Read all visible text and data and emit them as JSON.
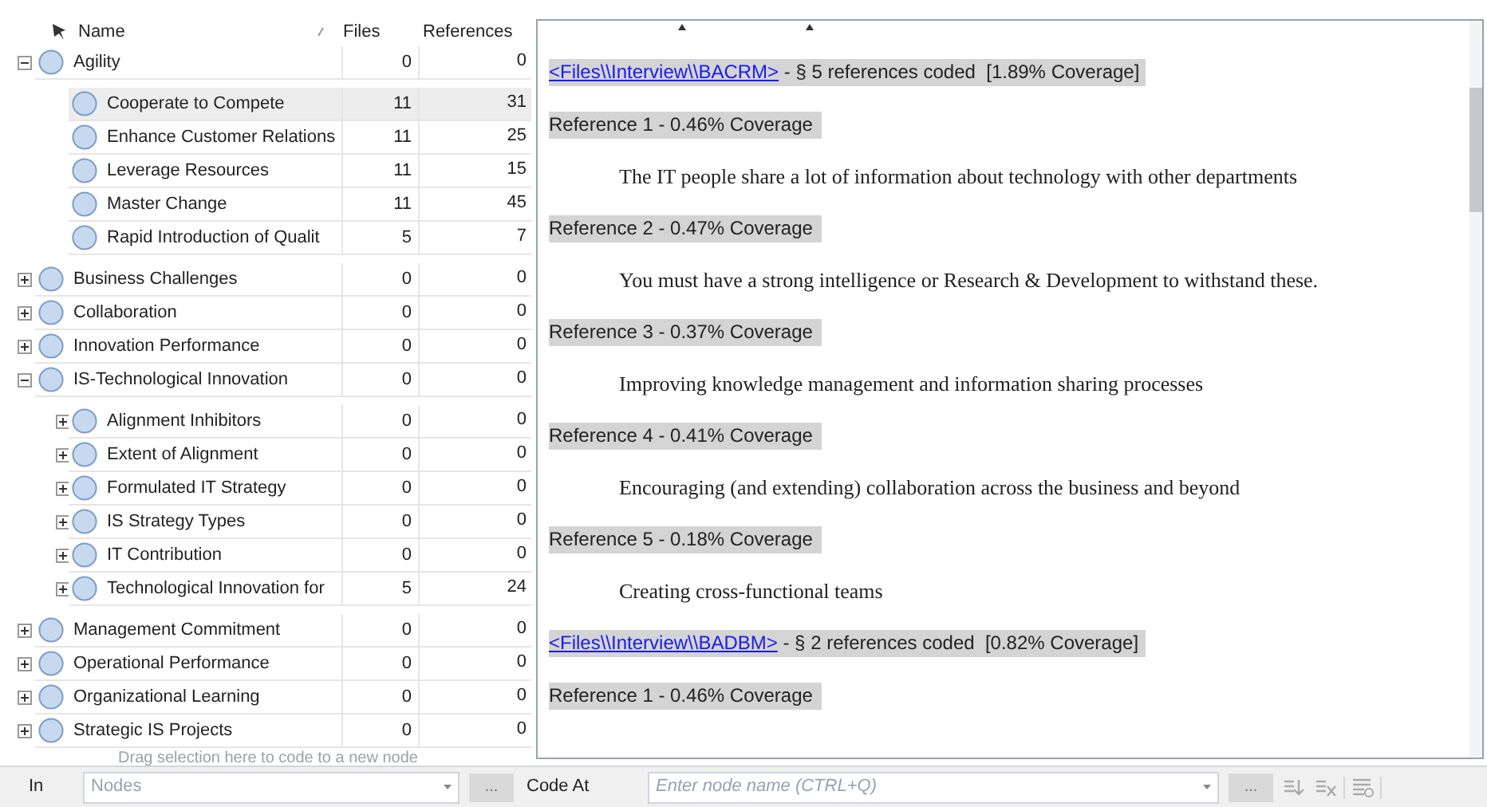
{
  "node_list": {
    "columns": [
      "Name",
      "Files",
      "References"
    ],
    "nodes": [
      {
        "name": "Agility",
        "files": "0",
        "references": "0",
        "expanded": true,
        "selected": false,
        "children": [
          {
            "name": "Cooperate to Compete",
            "files": "11",
            "references": "31",
            "selected": true
          },
          {
            "name": "Enhance Customer Relations",
            "files": "11",
            "references": "25",
            "selected": false
          },
          {
            "name": "Leverage Resources",
            "files": "11",
            "references": "15",
            "selected": false
          },
          {
            "name": "Master Change",
            "files": "11",
            "references": "45",
            "selected": false
          },
          {
            "name": "Rapid Introduction of Qualit",
            "files": "5",
            "references": "7",
            "selected": false
          }
        ]
      },
      {
        "name": "Business Challenges",
        "files": "0",
        "references": "0",
        "expanded": false,
        "selected": false
      },
      {
        "name": "Collaboration",
        "files": "0",
        "references": "0",
        "expanded": false,
        "selected": false
      },
      {
        "name": "Innovation Performance",
        "files": "0",
        "references": "0",
        "expanded": false,
        "selected": false
      },
      {
        "name": "IS-Technological Innovation",
        "files": "0",
        "references": "0",
        "expanded": true,
        "selected": false,
        "children": [
          {
            "name": "Alignment Inhibitors",
            "files": "0",
            "references": "0",
            "expanded": false,
            "selected": false
          },
          {
            "name": "Extent of Alignment",
            "files": "0",
            "references": "0",
            "expanded": false,
            "selected": false
          },
          {
            "name": "Formulated IT Strategy",
            "files": "0",
            "references": "0",
            "expanded": false,
            "selected": false
          },
          {
            "name": "IS Strategy Types",
            "files": "0",
            "references": "0",
            "expanded": false,
            "selected": false
          },
          {
            "name": "IT Contribution",
            "files": "0",
            "references": "0",
            "expanded": false,
            "selected": false
          },
          {
            "name": "Technological Innovation for",
            "files": "5",
            "references": "24",
            "expanded": false,
            "selected": false
          }
        ]
      },
      {
        "name": "Management Commitment",
        "files": "0",
        "references": "0",
        "expanded": false,
        "selected": false
      },
      {
        "name": "Operational Performance",
        "files": "0",
        "references": "0",
        "expanded": false,
        "selected": false
      },
      {
        "name": "Organizational Learning",
        "files": "0",
        "references": "0",
        "expanded": false,
        "selected": false
      },
      {
        "name": "Strategic IS Projects",
        "files": "0",
        "references": "0",
        "expanded": false,
        "selected": false
      }
    ],
    "drop_hint": "Drag selection here to code to a new node"
  },
  "detail_view": {
    "blocks": [
      {
        "kind": "source",
        "link": "<Files\\\\Interview\\\\BACRM>",
        "summary": " - § 5 references coded  [1.89% Coverage]"
      },
      {
        "kind": "reference",
        "text": "Reference 1 - 0.46% Coverage"
      },
      {
        "kind": "quote",
        "text": "The IT people share a lot of information about technology with other departments"
      },
      {
        "kind": "reference",
        "text": "Reference 2 - 0.47% Coverage"
      },
      {
        "kind": "quote",
        "text": "You must have a strong intelligence or Research & Development to withstand these."
      },
      {
        "kind": "reference",
        "text": "Reference 3 - 0.37% Coverage"
      },
      {
        "kind": "quote",
        "text": "Improving knowledge management and information sharing processes"
      },
      {
        "kind": "reference",
        "text": "Reference 4 - 0.41% Coverage"
      },
      {
        "kind": "quote",
        "text": "Encouraging (and extending) collaboration across the business and beyond"
      },
      {
        "kind": "reference",
        "text": "Reference 5 - 0.18% Coverage"
      },
      {
        "kind": "quote",
        "text": "Creating cross-functional teams"
      },
      {
        "kind": "source",
        "link": "<Files\\\\Interview\\\\BADBM>",
        "summary": " - § 2 references coded  [0.82% Coverage]"
      },
      {
        "kind": "reference",
        "text": "Reference 1 - 0.46% Coverage"
      }
    ]
  },
  "code_bar": {
    "in_label": "In",
    "in_placeholder": "Nodes",
    "in_button": "...",
    "code_at_label": "Code At",
    "code_at_placeholder": "Enter node name (CTRL+Q)",
    "code_at_button": "..."
  }
}
